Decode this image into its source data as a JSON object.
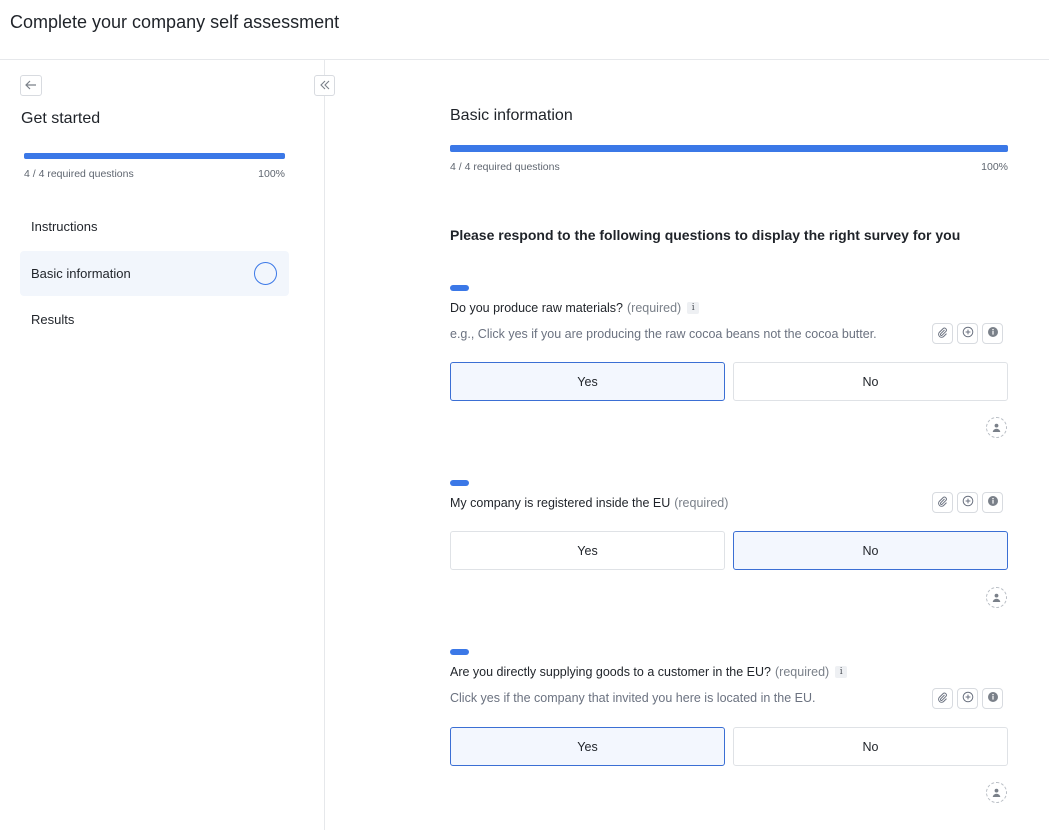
{
  "header": {
    "title": "Complete your company self assessment"
  },
  "sidebar": {
    "title": "Get started",
    "progress": {
      "text": "4 / 4 required questions",
      "percent_label": "100%",
      "fraction": 1.0
    },
    "items": [
      {
        "label": "Instructions"
      },
      {
        "label": "Basic information"
      },
      {
        "label": "Results"
      }
    ]
  },
  "main": {
    "section_title": "Basic information",
    "progress": {
      "text": "4 / 4 required questions",
      "percent_label": "100%",
      "fraction": 1.0
    },
    "intro": "Please respond to the following questions to display the right survey for you",
    "questions": [
      {
        "label": "Do you produce raw materials?",
        "required": "(required)",
        "info": "i",
        "hint": "e.g., Click yes if you are producing the raw cocoa beans not the cocoa butter.",
        "yes": "Yes",
        "no": "No",
        "selected": "yes"
      },
      {
        "label": "My company is registered inside the EU",
        "required": "(required)",
        "yes": "Yes",
        "no": "No",
        "selected": "no"
      },
      {
        "label": "Are you directly supplying goods to a customer in the EU?",
        "required": "(required)",
        "info": "i",
        "hint": "Click yes if the company that invited you here is located in the EU.",
        "yes": "Yes",
        "no": "No",
        "selected": "yes"
      }
    ]
  },
  "colors": {
    "accent": "#3b78e7",
    "selected_border": "#3b6fd4",
    "selected_bg": "#f3f7fe",
    "active_nav_bg": "#f2f6fc"
  },
  "icons": [
    "arrow-left-icon",
    "chevrons-left-icon",
    "paperclip-icon",
    "comment-plus-icon",
    "info-circle-icon",
    "assign-user-icon"
  ]
}
